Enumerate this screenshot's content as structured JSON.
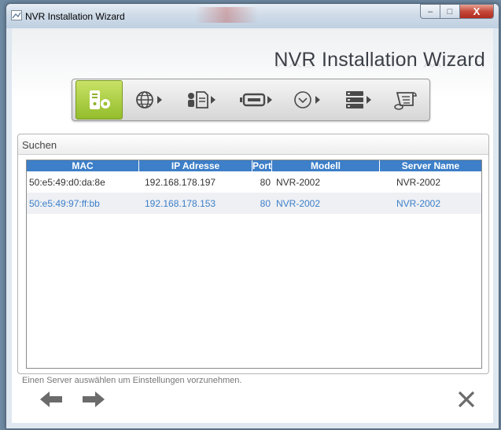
{
  "window": {
    "title": "NVR Installation Wizard",
    "buttons": {
      "minimize": "–",
      "maximize": "□",
      "close": "X"
    }
  },
  "header": {
    "title": "NVR Installation Wizard"
  },
  "steps": [
    {
      "icon": "nvr-settings-icon",
      "active": true
    },
    {
      "icon": "globe-icon",
      "active": false
    },
    {
      "icon": "user-document-icon",
      "active": false
    },
    {
      "icon": "disk-drive-icon",
      "active": false
    },
    {
      "icon": "clock-icon",
      "active": false
    },
    {
      "icon": "server-rack-icon",
      "active": false
    },
    {
      "icon": "finish-scroll-icon",
      "active": false
    }
  ],
  "search_panel": {
    "label": "Suchen",
    "columns": [
      "MAC",
      "IP Adresse",
      "Port",
      "Modell",
      "Server Name"
    ],
    "rows": [
      {
        "mac": "50:e5:49:d0:da:8e",
        "ip": "192.168.178.197",
        "port": "80",
        "model": "NVR-2002",
        "server": "NVR-2002"
      },
      {
        "mac": "50:e5:49:97:ff:bb",
        "ip": "192.168.178.153",
        "port": "80",
        "model": "NVR-2002",
        "server": "NVR-2002"
      }
    ]
  },
  "status_text": "Einen Server auswählen um Einstellungen vorzunehmen.",
  "colors": {
    "accent": "#3d7fc8",
    "active_step": "#93bd2c",
    "nav_arrow": "#6b6b6b"
  }
}
